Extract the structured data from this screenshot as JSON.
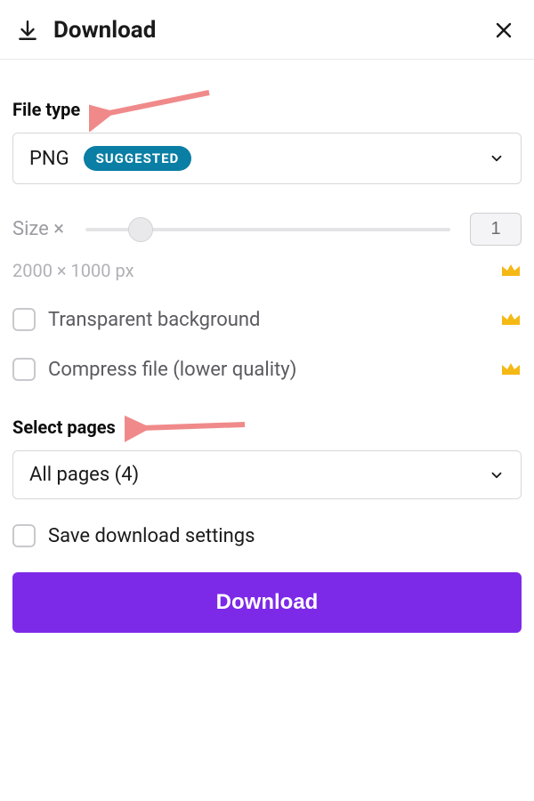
{
  "header": {
    "title": "Download"
  },
  "fileType": {
    "label": "File type",
    "value": "PNG",
    "badge": "SUGGESTED"
  },
  "size": {
    "label": "Size ×",
    "value": "1",
    "dimensions": "2000 × 1000 px"
  },
  "options": {
    "transparent": "Transparent background",
    "compress": "Compress file (lower quality)"
  },
  "selectPages": {
    "label": "Select pages",
    "value": "All pages (4)"
  },
  "saveSettings": {
    "label": "Save download settings"
  },
  "actions": {
    "download": "Download"
  }
}
